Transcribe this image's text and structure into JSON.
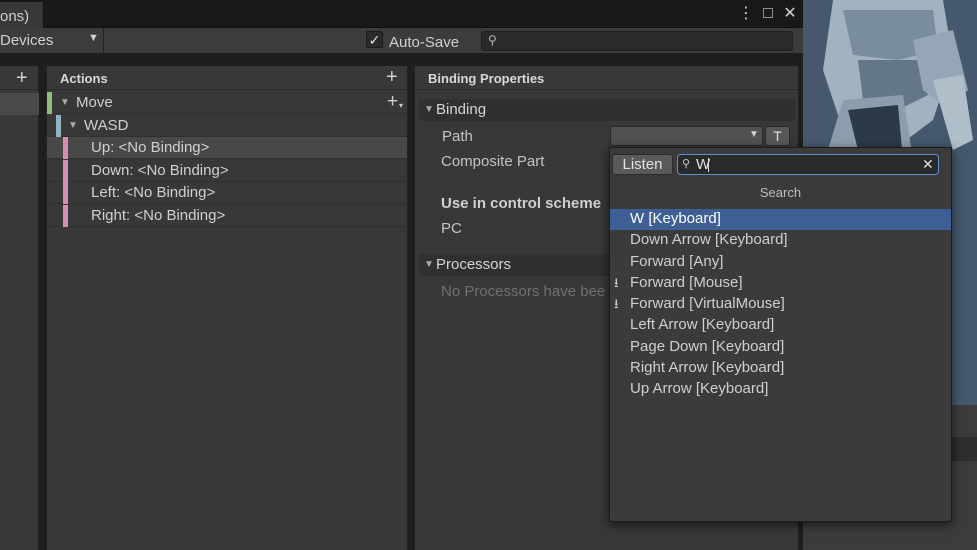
{
  "window": {
    "tab_title": "ons)",
    "menu_icon": "⋮",
    "maximize_icon": "□",
    "close_icon": "✕"
  },
  "toolbar": {
    "devices_label": "Devices",
    "autosave_label": "Auto-Save",
    "autosave_checked": true,
    "search_value": ""
  },
  "actions_panel": {
    "header": "Actions",
    "items": [
      {
        "label": "Move",
        "kind": "action",
        "color": "#8fbf7f"
      },
      {
        "label": "WASD",
        "kind": "composite",
        "color": "#8fb3bf"
      },
      {
        "label": "Up: <No Binding>",
        "kind": "part",
        "color": "#d58fb0"
      },
      {
        "label": "Down: <No Binding>",
        "kind": "part",
        "color": "#d58fb0"
      },
      {
        "label": "Left: <No Binding>",
        "kind": "part",
        "color": "#d58fb0"
      },
      {
        "label": "Right: <No Binding>",
        "kind": "part",
        "color": "#d58fb0"
      }
    ]
  },
  "binding_panel": {
    "header": "Binding Properties",
    "binding_section": "Binding",
    "path_label": "Path",
    "path_value": "",
    "t_button": "T",
    "composite_part_label": "Composite Part",
    "control_scheme_label": "Use in control scheme",
    "control_scheme_pc": "PC",
    "processors_section": "Processors",
    "processors_empty": "No Processors have bee"
  },
  "path_popup": {
    "listen_label": "Listen",
    "search_value": "W",
    "heading": "Search",
    "options": [
      {
        "label": "W [Keyboard]",
        "selected": true,
        "download_icon": false
      },
      {
        "label": "Down Arrow [Keyboard]",
        "selected": false,
        "download_icon": false
      },
      {
        "label": "Forward [Any]",
        "selected": false,
        "download_icon": false
      },
      {
        "label": "Forward [Mouse]",
        "selected": false,
        "download_icon": true
      },
      {
        "label": "Forward [VirtualMouse]",
        "selected": false,
        "download_icon": true
      },
      {
        "label": "Left Arrow [Keyboard]",
        "selected": false,
        "download_icon": false
      },
      {
        "label": "Page Down [Keyboard]",
        "selected": false,
        "download_icon": false
      },
      {
        "label": "Right Arrow [Keyboard]",
        "selected": false,
        "download_icon": false
      },
      {
        "label": "Up Arrow [Keyboard]",
        "selected": false,
        "download_icon": false
      }
    ]
  },
  "colors": {
    "selection": "#3e5f96",
    "focus_border": "#5f8fd0"
  }
}
